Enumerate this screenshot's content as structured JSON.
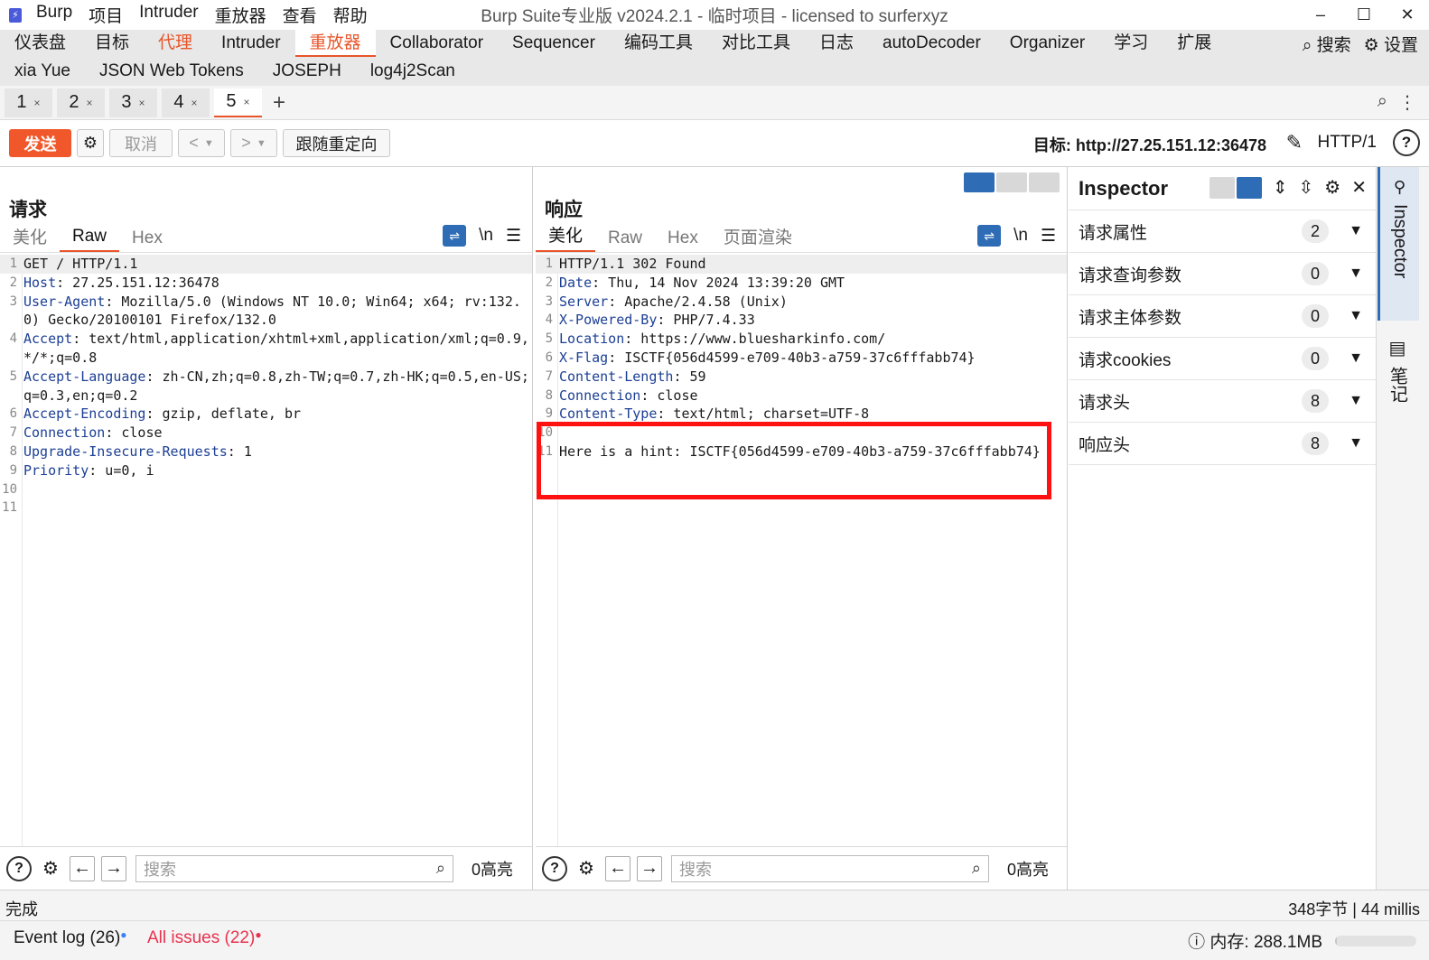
{
  "titlebar": {
    "menu": [
      "Burp",
      "项目",
      "Intruder",
      "重放器",
      "查看",
      "帮助"
    ],
    "title": "Burp Suite专业版  v2024.2.1 - 临时项目 - licensed to surferxyz",
    "minimize": "–",
    "maximize": "☐",
    "close": "✕"
  },
  "nav": {
    "row1": [
      "仪表盘",
      "目标",
      "代理",
      "Intruder",
      "重放器",
      "Collaborator",
      "Sequencer",
      "编码工具",
      "对比工具",
      "日志",
      "autoDecoder",
      "Organizer",
      "学习",
      "扩展"
    ],
    "row2": [
      "xia Yue",
      "JSON Web Tokens",
      "JOSEPH",
      "log4j2Scan"
    ],
    "search": "搜索",
    "settings": "设置"
  },
  "tabs": [
    {
      "label": "1",
      "close": "×"
    },
    {
      "label": "2",
      "close": "×"
    },
    {
      "label": "3",
      "close": "×"
    },
    {
      "label": "4",
      "close": "×"
    },
    {
      "label": "5",
      "close": "×"
    }
  ],
  "tabs_add": "+",
  "toolbar": {
    "send": "发送",
    "cancel": "取消",
    "back": "<",
    "fwd": ">",
    "follow_redirect": "跟随重定向",
    "target": "目标: http://27.25.151.12:36478",
    "http_version": "HTTP/1"
  },
  "request": {
    "title": "请求",
    "tabs": [
      "美化",
      "Raw",
      "Hex"
    ],
    "newline": "\\n",
    "lines": [
      {
        "n": "1",
        "k": "",
        "v": "GET / HTTP/1.1"
      },
      {
        "n": "2",
        "k": "Host",
        "v": ": 27.25.151.12:36478"
      },
      {
        "n": "3",
        "k": "User-Agent",
        "v": ": Mozilla/5.0 (Windows NT 10.0; Win64; x64; rv:132.0) Gecko/20100101 Firefox/132.0"
      },
      {
        "n": "4",
        "k": "Accept",
        "v": ": text/html,application/xhtml+xml,application/xml;q=0.9,*/*;q=0.8"
      },
      {
        "n": "5",
        "k": "Accept-Language",
        "v": ": zh-CN,zh;q=0.8,zh-TW;q=0.7,zh-HK;q=0.5,en-US;q=0.3,en;q=0.2"
      },
      {
        "n": "6",
        "k": "Accept-Encoding",
        "v": ": gzip, deflate, br"
      },
      {
        "n": "7",
        "k": "Connection",
        "v": ": close"
      },
      {
        "n": "8",
        "k": "Upgrade-Insecure-Requests",
        "v": ": 1"
      },
      {
        "n": "9",
        "k": "Priority",
        "v": ": u=0, i"
      },
      {
        "n": "10",
        "k": "",
        "v": ""
      },
      {
        "n": "11",
        "k": "",
        "v": ""
      }
    ],
    "search_placeholder": "搜索",
    "highlights": "0高亮"
  },
  "response": {
    "title": "响应",
    "tabs": [
      "美化",
      "Raw",
      "Hex",
      "页面渲染"
    ],
    "newline": "\\n",
    "lines": [
      {
        "n": "1",
        "k": "",
        "v": "HTTP/1.1 302 Found"
      },
      {
        "n": "2",
        "k": "Date",
        "v": ": Thu, 14 Nov 2024 13:39:20 GMT"
      },
      {
        "n": "3",
        "k": "Server",
        "v": ": Apache/2.4.58 (Unix)"
      },
      {
        "n": "4",
        "k": "X-Powered-By",
        "v": ": PHP/7.4.33"
      },
      {
        "n": "5",
        "k": "Location",
        "v": ": https://www.bluesharkinfo.com/"
      },
      {
        "n": "6",
        "k": "X-Flag",
        "v": ": ISCTF{056d4599-e709-40b3-a759-37c6fffabb74}"
      },
      {
        "n": "7",
        "k": "Content-Length",
        "v": ": 59"
      },
      {
        "n": "8",
        "k": "Connection",
        "v": ": close"
      },
      {
        "n": "9",
        "k": "Content-Type",
        "v": ": text/html; charset=UTF-8"
      },
      {
        "n": "10",
        "k": "",
        "v": ""
      },
      {
        "n": "11",
        "k": "",
        "v": "Here is a hint: ISCTF{056d4599-e709-40b3-a759-37c6fffabb74}"
      }
    ],
    "search_placeholder": "搜索",
    "highlights": "0高亮"
  },
  "inspector": {
    "title": "Inspector",
    "rows": [
      {
        "label": "请求属性",
        "count": "2"
      },
      {
        "label": "请求查询参数",
        "count": "0"
      },
      {
        "label": "请求主体参数",
        "count": "0"
      },
      {
        "label": "请求cookies",
        "count": "0"
      },
      {
        "label": "请求头",
        "count": "8"
      },
      {
        "label": "响应头",
        "count": "8"
      }
    ],
    "side_tab": "Inspector",
    "side_tab2": "笔记"
  },
  "status": {
    "left": "完成",
    "right": "348字节 | 44 millis"
  },
  "footer": {
    "event_log": "Event log (26)",
    "all_issues": "All issues (22)",
    "memory": "内存: 288.1MB",
    "memory_fraction": 0.02
  },
  "colors": {
    "accent": "#e8552a",
    "send": "#f0572a",
    "highlight_box": "#ff1111",
    "header_key": "#1c3f94",
    "selection_blue": "#2e6cb5"
  }
}
